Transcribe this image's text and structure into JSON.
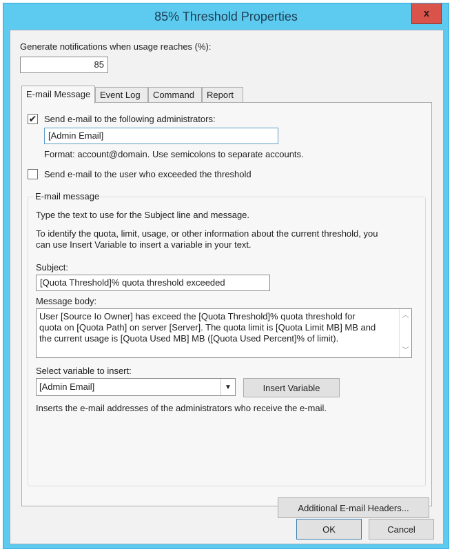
{
  "window": {
    "title": "85% Threshold Properties",
    "close_label": "x",
    "colors": {
      "frame": "#5ccbef",
      "close": "#d9534a",
      "client": "#f2f2f2"
    }
  },
  "threshold": {
    "label": "Generate notifications when usage reaches (%):",
    "value": "85"
  },
  "tabs": [
    {
      "label": "E-mail Message",
      "active": true
    },
    {
      "label": "Event Log",
      "active": false
    },
    {
      "label": "Command",
      "active": false
    },
    {
      "label": "Report",
      "active": false
    }
  ],
  "email_tab": {
    "send_admins": {
      "label": "Send e-mail to the following administrators:",
      "checked": true,
      "check_glyph": "✔",
      "value": "[Admin Email]",
      "format_hint": "Format: account@domain. Use semicolons to separate accounts."
    },
    "send_user": {
      "label": "Send e-mail to the user who exceeded the threshold",
      "checked": false
    },
    "group": {
      "label": "E-mail message",
      "intro": "Type the text to use for the Subject line and message.",
      "help_line1": "To identify the quota, limit, usage, or other information about the current threshold, you",
      "help_line2": "can use Insert Variable to insert a variable in your text.",
      "subject_label": "Subject:",
      "subject_value": "[Quota Threshold]% quota threshold exceeded",
      "body_label": "Message body:",
      "body_lines": [
        "User [Source Io Owner] has exceed the [Quota Threshold]% quota threshold for",
        "quota on [Quota Path] on server [Server]. The quota limit is [Quota Limit MB] MB and",
        "the current usage is [Quota Used MB] MB ([Quota Used Percent]% of limit)."
      ],
      "scroll_up": "︿",
      "scroll_down": "﹀",
      "variable_label": "Select variable to insert:",
      "variable_selected": "[Admin Email]",
      "dropdown_glyph": "▼",
      "insert_button": "Insert Variable",
      "variable_description": "Inserts the e-mail addresses of the administrators who receive the e-mail."
    },
    "headers_button": "Additional E-mail Headers..."
  },
  "footer": {
    "ok": "OK",
    "cancel": "Cancel"
  }
}
